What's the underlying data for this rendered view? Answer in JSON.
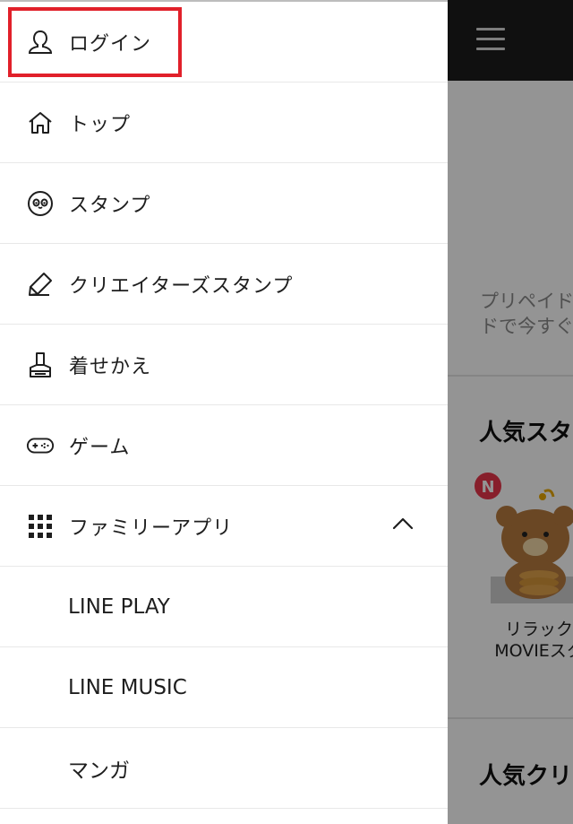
{
  "background": {
    "promo_text": "プリペイド\nドで今すぐ",
    "section_popular_stamps": "人気スタ",
    "sticker_badge": "N",
    "sticker_caption": "リラック\nMOVIEスタ",
    "section_popular_creators": "人気クリ"
  },
  "drawer": {
    "items": [
      {
        "label": "ログイン",
        "icon": "user-icon"
      },
      {
        "label": "トップ",
        "icon": "home-icon"
      },
      {
        "label": "スタンプ",
        "icon": "face-icon"
      },
      {
        "label": "クリエイターズスタンプ",
        "icon": "pencil-icon"
      },
      {
        "label": "着せかえ",
        "icon": "brush-icon"
      },
      {
        "label": "ゲーム",
        "icon": "gamepad-icon"
      },
      {
        "label": "ファミリーアプリ",
        "icon": "grid-icon"
      }
    ],
    "family_apps": [
      {
        "label": "LINE PLAY"
      },
      {
        "label": "LINE MUSIC"
      },
      {
        "label": "マンガ"
      }
    ]
  },
  "colors": {
    "highlight": "#e1202a",
    "header_bg": "#1c1c1c",
    "badge": "#e8364a"
  }
}
